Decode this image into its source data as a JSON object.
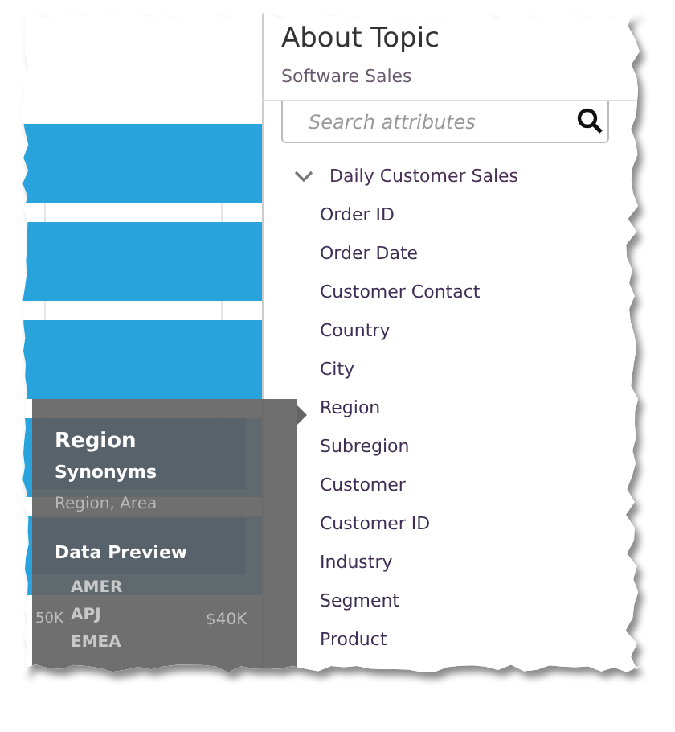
{
  "chart": {
    "axis_labels": [
      "50K",
      "$40K"
    ]
  },
  "tooltip": {
    "title": "Region",
    "synonyms_heading": "Synonyms",
    "synonyms": "Region, Area",
    "preview_heading": "Data Preview",
    "preview_values": [
      "AMER",
      "APJ",
      "EMEA"
    ]
  },
  "panel": {
    "title": "About Topic",
    "subtitle": "Software Sales",
    "search": {
      "placeholder": "Search attributes"
    },
    "tree": [
      {
        "label": "Daily Customer Sales",
        "expanded": true,
        "children": [
          {
            "label": "Order ID"
          },
          {
            "label": "Order Date"
          },
          {
            "label": "Customer Contact"
          },
          {
            "label": "Country"
          },
          {
            "label": "City"
          },
          {
            "label": "Region"
          },
          {
            "label": "Subregion"
          },
          {
            "label": "Customer"
          },
          {
            "label": "Customer ID"
          },
          {
            "label": "Industry"
          },
          {
            "label": "Segment"
          },
          {
            "label": "Product"
          }
        ]
      }
    ]
  }
}
